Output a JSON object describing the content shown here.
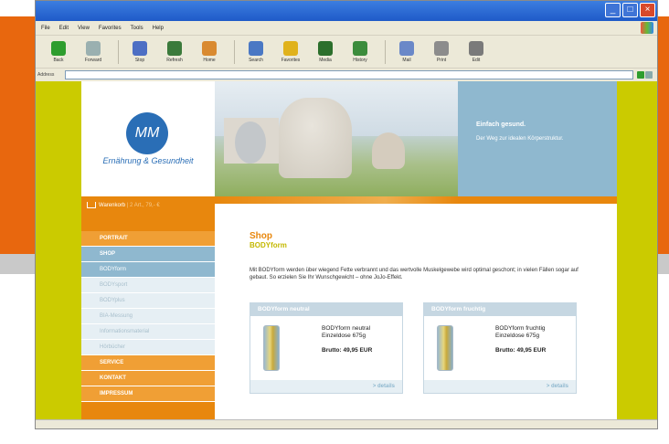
{
  "browser": {
    "menu": [
      "File",
      "Edit",
      "View",
      "Favorites",
      "Tools",
      "Help"
    ],
    "toolbar": [
      {
        "label": "Back",
        "icon": "back-icon",
        "color": "#2e9d2e"
      },
      {
        "label": "Forward",
        "icon": "forward-icon",
        "color": "#9ab0b0"
      },
      {
        "label": "Stop",
        "icon": "stop-icon",
        "color": "#4d6fc4"
      },
      {
        "label": "Refresh",
        "icon": "refresh-icon",
        "color": "#3b7a3b"
      },
      {
        "label": "Home",
        "icon": "home-icon",
        "color": "#d98a30"
      },
      {
        "label": "Search",
        "icon": "search-icon",
        "color": "#4a78c4"
      },
      {
        "label": "Favorites",
        "icon": "star-icon",
        "color": "#e0b21c"
      },
      {
        "label": "Media",
        "icon": "media-icon",
        "color": "#2c6f2c"
      },
      {
        "label": "History",
        "icon": "history-icon",
        "color": "#3c8c3c"
      },
      {
        "label": "Mail",
        "icon": "mail-icon",
        "color": "#6a88c8"
      },
      {
        "label": "Print",
        "icon": "print-icon",
        "color": "#8c8c8c"
      },
      {
        "label": "Edit",
        "icon": "edit-icon",
        "color": "#7a7a7a"
      }
    ],
    "address_label": "Address",
    "address_value": ""
  },
  "site": {
    "logo_text": "MM",
    "tagline": "Ernährung & Gesundheit",
    "promo_title": "Einfach gesund.",
    "promo_text": "Der Weg zur idealen Körperstruktur.",
    "cart_label": "Warenkorb",
    "cart_info": "| 2 Art., 79,- €",
    "nav": [
      {
        "label": "PORTRAIT",
        "type": "main"
      },
      {
        "label": "SHOP",
        "type": "active"
      },
      {
        "label": "BODYform",
        "type": "sub-active"
      },
      {
        "label": "BODYsport",
        "type": "sub"
      },
      {
        "label": "BODYplus",
        "type": "sub"
      },
      {
        "label": "BIA-Messung",
        "type": "sub"
      },
      {
        "label": "Informationsmaterial",
        "type": "sub"
      },
      {
        "label": "Hörbücher",
        "type": "sub"
      },
      {
        "label": "SERVICE",
        "type": "main"
      },
      {
        "label": "KONTAKT",
        "type": "main"
      },
      {
        "label": "IMPRESSUM",
        "type": "main"
      }
    ]
  },
  "content": {
    "title": "Shop",
    "subtitle": "BODYform",
    "intro": "Mit BODYform werden über wiegend Fette verbrannt und das wertvolle Muskelgewebe wird optimal geschont; in vielen Fällen sogar auf gebaut. So erzielen Sie Ihr Wunschgewicht – ohne JoJo-Effekt.",
    "products": [
      {
        "header": "BODYform neutral",
        "name": "BODYform neutral",
        "size": "Einzeldose 675g",
        "price": "Brutto: 49,95 EUR",
        "details": "> details"
      },
      {
        "header": "BODYform fruchtig",
        "name": "BODYform fruchtig",
        "size": "Einzeldose 675g",
        "price": "Brutto: 49,95 EUR",
        "details": "> details"
      }
    ]
  }
}
